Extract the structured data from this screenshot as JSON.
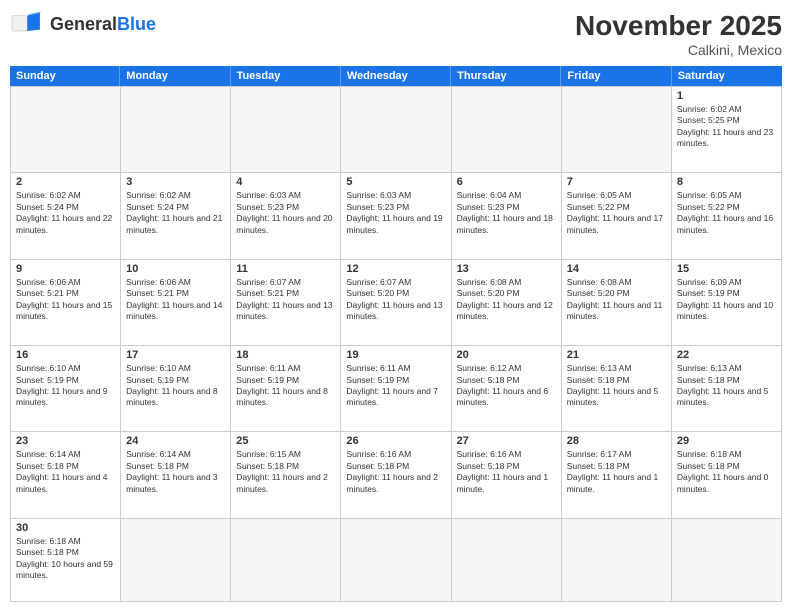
{
  "header": {
    "logo_general": "General",
    "logo_blue": "Blue",
    "month": "November 2025",
    "location": "Calkini, Mexico"
  },
  "days_of_week": [
    "Sunday",
    "Monday",
    "Tuesday",
    "Wednesday",
    "Thursday",
    "Friday",
    "Saturday"
  ],
  "weeks": [
    [
      {
        "day": "",
        "empty": true
      },
      {
        "day": "",
        "empty": true
      },
      {
        "day": "",
        "empty": true
      },
      {
        "day": "",
        "empty": true
      },
      {
        "day": "",
        "empty": true
      },
      {
        "day": "",
        "empty": true
      },
      {
        "day": "1",
        "sunrise": "Sunrise: 6:02 AM",
        "sunset": "Sunset: 5:25 PM",
        "daylight": "Daylight: 11 hours and 23 minutes."
      }
    ],
    [
      {
        "day": "2",
        "sunrise": "Sunrise: 6:02 AM",
        "sunset": "Sunset: 5:24 PM",
        "daylight": "Daylight: 11 hours and 22 minutes."
      },
      {
        "day": "3",
        "sunrise": "Sunrise: 6:02 AM",
        "sunset": "Sunset: 5:24 PM",
        "daylight": "Daylight: 11 hours and 21 minutes."
      },
      {
        "day": "4",
        "sunrise": "Sunrise: 6:03 AM",
        "sunset": "Sunset: 5:23 PM",
        "daylight": "Daylight: 11 hours and 20 minutes."
      },
      {
        "day": "5",
        "sunrise": "Sunrise: 6:03 AM",
        "sunset": "Sunset: 5:23 PM",
        "daylight": "Daylight: 11 hours and 19 minutes."
      },
      {
        "day": "6",
        "sunrise": "Sunrise: 6:04 AM",
        "sunset": "Sunset: 5:23 PM",
        "daylight": "Daylight: 11 hours and 18 minutes."
      },
      {
        "day": "7",
        "sunrise": "Sunrise: 6:05 AM",
        "sunset": "Sunset: 5:22 PM",
        "daylight": "Daylight: 11 hours and 17 minutes."
      },
      {
        "day": "8",
        "sunrise": "Sunrise: 6:05 AM",
        "sunset": "Sunset: 5:22 PM",
        "daylight": "Daylight: 11 hours and 16 minutes."
      }
    ],
    [
      {
        "day": "9",
        "sunrise": "Sunrise: 6:06 AM",
        "sunset": "Sunset: 5:21 PM",
        "daylight": "Daylight: 11 hours and 15 minutes."
      },
      {
        "day": "10",
        "sunrise": "Sunrise: 6:06 AM",
        "sunset": "Sunset: 5:21 PM",
        "daylight": "Daylight: 11 hours and 14 minutes."
      },
      {
        "day": "11",
        "sunrise": "Sunrise: 6:07 AM",
        "sunset": "Sunset: 5:21 PM",
        "daylight": "Daylight: 11 hours and 13 minutes."
      },
      {
        "day": "12",
        "sunrise": "Sunrise: 6:07 AM",
        "sunset": "Sunset: 5:20 PM",
        "daylight": "Daylight: 11 hours and 13 minutes."
      },
      {
        "day": "13",
        "sunrise": "Sunrise: 6:08 AM",
        "sunset": "Sunset: 5:20 PM",
        "daylight": "Daylight: 11 hours and 12 minutes."
      },
      {
        "day": "14",
        "sunrise": "Sunrise: 6:08 AM",
        "sunset": "Sunset: 5:20 PM",
        "daylight": "Daylight: 11 hours and 11 minutes."
      },
      {
        "day": "15",
        "sunrise": "Sunrise: 6:09 AM",
        "sunset": "Sunset: 5:19 PM",
        "daylight": "Daylight: 11 hours and 10 minutes."
      }
    ],
    [
      {
        "day": "16",
        "sunrise": "Sunrise: 6:10 AM",
        "sunset": "Sunset: 5:19 PM",
        "daylight": "Daylight: 11 hours and 9 minutes."
      },
      {
        "day": "17",
        "sunrise": "Sunrise: 6:10 AM",
        "sunset": "Sunset: 5:19 PM",
        "daylight": "Daylight: 11 hours and 8 minutes."
      },
      {
        "day": "18",
        "sunrise": "Sunrise: 6:11 AM",
        "sunset": "Sunset: 5:19 PM",
        "daylight": "Daylight: 11 hours and 8 minutes."
      },
      {
        "day": "19",
        "sunrise": "Sunrise: 6:11 AM",
        "sunset": "Sunset: 5:19 PM",
        "daylight": "Daylight: 11 hours and 7 minutes."
      },
      {
        "day": "20",
        "sunrise": "Sunrise: 6:12 AM",
        "sunset": "Sunset: 5:18 PM",
        "daylight": "Daylight: 11 hours and 6 minutes."
      },
      {
        "day": "21",
        "sunrise": "Sunrise: 6:13 AM",
        "sunset": "Sunset: 5:18 PM",
        "daylight": "Daylight: 11 hours and 5 minutes."
      },
      {
        "day": "22",
        "sunrise": "Sunrise: 6:13 AM",
        "sunset": "Sunset: 5:18 PM",
        "daylight": "Daylight: 11 hours and 5 minutes."
      }
    ],
    [
      {
        "day": "23",
        "sunrise": "Sunrise: 6:14 AM",
        "sunset": "Sunset: 5:18 PM",
        "daylight": "Daylight: 11 hours and 4 minutes."
      },
      {
        "day": "24",
        "sunrise": "Sunrise: 6:14 AM",
        "sunset": "Sunset: 5:18 PM",
        "daylight": "Daylight: 11 hours and 3 minutes."
      },
      {
        "day": "25",
        "sunrise": "Sunrise: 6:15 AM",
        "sunset": "Sunset: 5:18 PM",
        "daylight": "Daylight: 11 hours and 2 minutes."
      },
      {
        "day": "26",
        "sunrise": "Sunrise: 6:16 AM",
        "sunset": "Sunset: 5:18 PM",
        "daylight": "Daylight: 11 hours and 2 minutes."
      },
      {
        "day": "27",
        "sunrise": "Sunrise: 6:16 AM",
        "sunset": "Sunset: 5:18 PM",
        "daylight": "Daylight: 11 hours and 1 minute."
      },
      {
        "day": "28",
        "sunrise": "Sunrise: 6:17 AM",
        "sunset": "Sunset: 5:18 PM",
        "daylight": "Daylight: 11 hours and 1 minute."
      },
      {
        "day": "29",
        "sunrise": "Sunrise: 6:18 AM",
        "sunset": "Sunset: 5:18 PM",
        "daylight": "Daylight: 11 hours and 0 minutes."
      }
    ],
    [
      {
        "day": "30",
        "sunrise": "Sunrise: 6:18 AM",
        "sunset": "Sunset: 5:18 PM",
        "daylight": "Daylight: 10 hours and 59 minutes."
      },
      {
        "day": "",
        "empty": true
      },
      {
        "day": "",
        "empty": true
      },
      {
        "day": "",
        "empty": true
      },
      {
        "day": "",
        "empty": true
      },
      {
        "day": "",
        "empty": true
      },
      {
        "day": "",
        "empty": true
      }
    ]
  ]
}
